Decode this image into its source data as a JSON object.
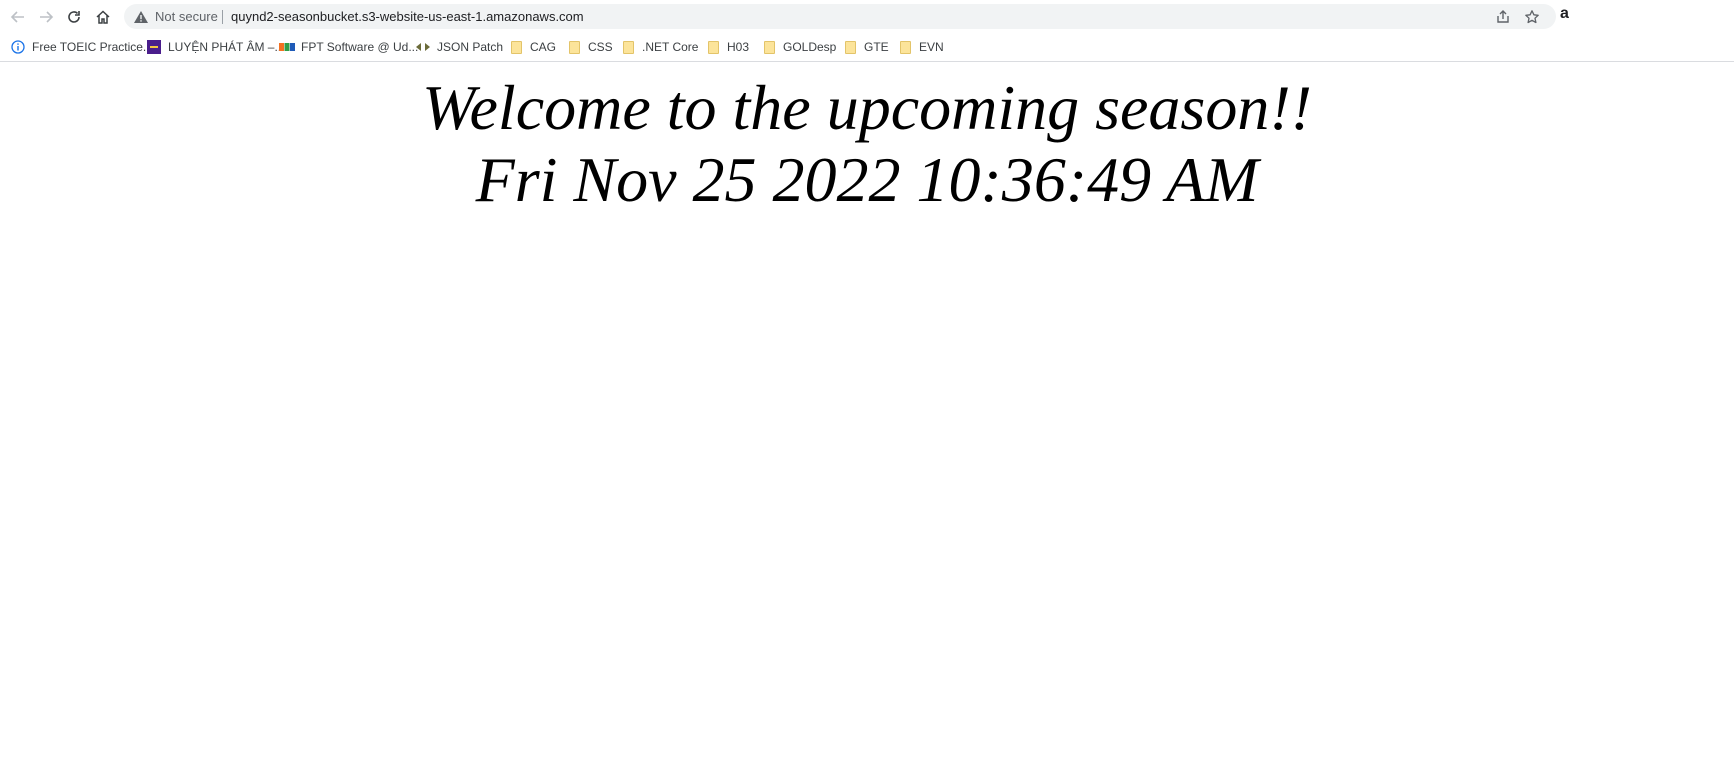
{
  "browser": {
    "security_label": "Not secure",
    "url": "quynd2-seasonbucket.s3-website-us-east-1.amazonaws.com",
    "profile_partial": "a",
    "nav_icons": [
      "back-icon",
      "forward-icon",
      "reload-icon",
      "home-icon"
    ],
    "omnibox_icons": [
      "warning-icon",
      "share-icon",
      "star-icon"
    ]
  },
  "bookmarks": [
    {
      "label": "Free TOEIC Practice...",
      "icon": "info-icon"
    },
    {
      "label": "LUYỆN PHÁT ÂM –...",
      "icon": "site-favicon"
    },
    {
      "label": "FPT Software @ Ud...",
      "icon": "fpt-favicon"
    },
    {
      "label": "JSON Patch",
      "icon": "json-patch-favicon"
    },
    {
      "label": "CAG",
      "icon": "folder-icon"
    },
    {
      "label": "CSS",
      "icon": "folder-icon"
    },
    {
      "label": ".NET Core",
      "icon": "folder-icon"
    },
    {
      "label": "H03",
      "icon": "folder-icon"
    },
    {
      "label": "GOLDesp",
      "icon": "folder-icon"
    },
    {
      "label": "GTE",
      "icon": "folder-icon"
    },
    {
      "label": "EVN",
      "icon": "folder-icon"
    }
  ],
  "page": {
    "heading": "Welcome to the upcoming season!!",
    "datetime": "Fri Nov 25 2022 10:36:49 AM"
  },
  "colors": {
    "omnibox_bg": "#f1f3f4",
    "folder": "#fce49a",
    "text": "#000000"
  }
}
